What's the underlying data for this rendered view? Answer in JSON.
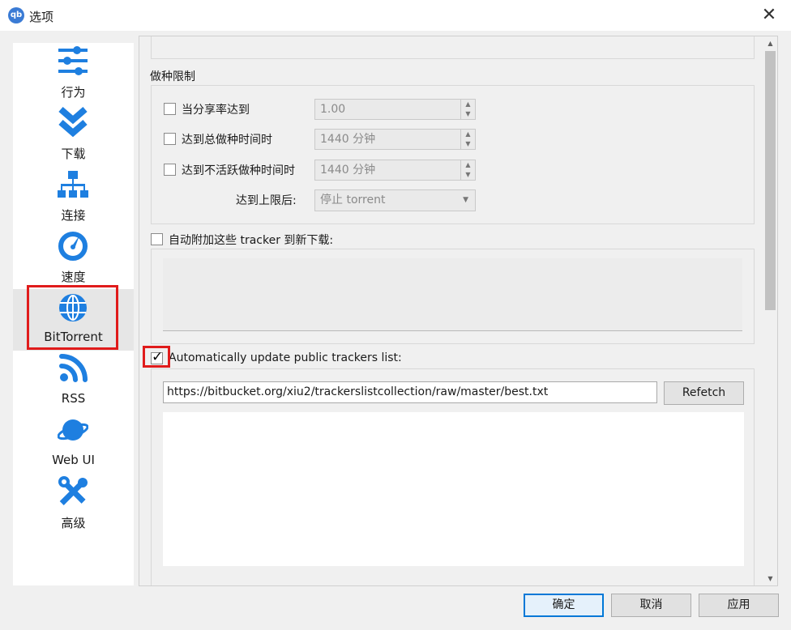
{
  "window": {
    "title": "选项",
    "app_icon_text": "qb",
    "close_glyph": "✕"
  },
  "sidebar": {
    "items": [
      {
        "label": "行为",
        "icon": "sliders-icon"
      },
      {
        "label": "下载",
        "icon": "double-chevron-down-icon"
      },
      {
        "label": "连接",
        "icon": "network-icon"
      },
      {
        "label": "速度",
        "icon": "speedometer-icon"
      },
      {
        "label": "BitTorrent",
        "icon": "globe-icon",
        "selected": true
      },
      {
        "label": "RSS",
        "icon": "rss-icon"
      },
      {
        "label": "Web UI",
        "icon": "planet-icon"
      },
      {
        "label": "高级",
        "icon": "tools-icon"
      }
    ]
  },
  "seeding_limits": {
    "title": "做种限制",
    "ratio": {
      "label": "当分享率达到",
      "checked": false,
      "value": "1.00"
    },
    "total_time": {
      "label": "达到总做种时间时",
      "checked": false,
      "value": "1440 分钟"
    },
    "inactive_time": {
      "label": "达到不活跃做种时间时",
      "checked": false,
      "value": "1440 分钟"
    },
    "action": {
      "label": "达到上限后:",
      "value": "停止 torrent"
    }
  },
  "add_trackers": {
    "label": "自动附加这些 tracker 到新下载:",
    "checked": false
  },
  "auto_update": {
    "label": "Automatically update public trackers list:",
    "checked": true,
    "url": "https://bitbucket.org/xiu2/trackerslistcollection/raw/master/best.txt",
    "refetch_label": "Refetch"
  },
  "buttons": {
    "ok": "确定",
    "cancel": "取消",
    "apply": "应用"
  },
  "colors": {
    "accent": "#1e7fe0",
    "highlight": "#e01b1b",
    "default_button_border": "#0078d7"
  }
}
